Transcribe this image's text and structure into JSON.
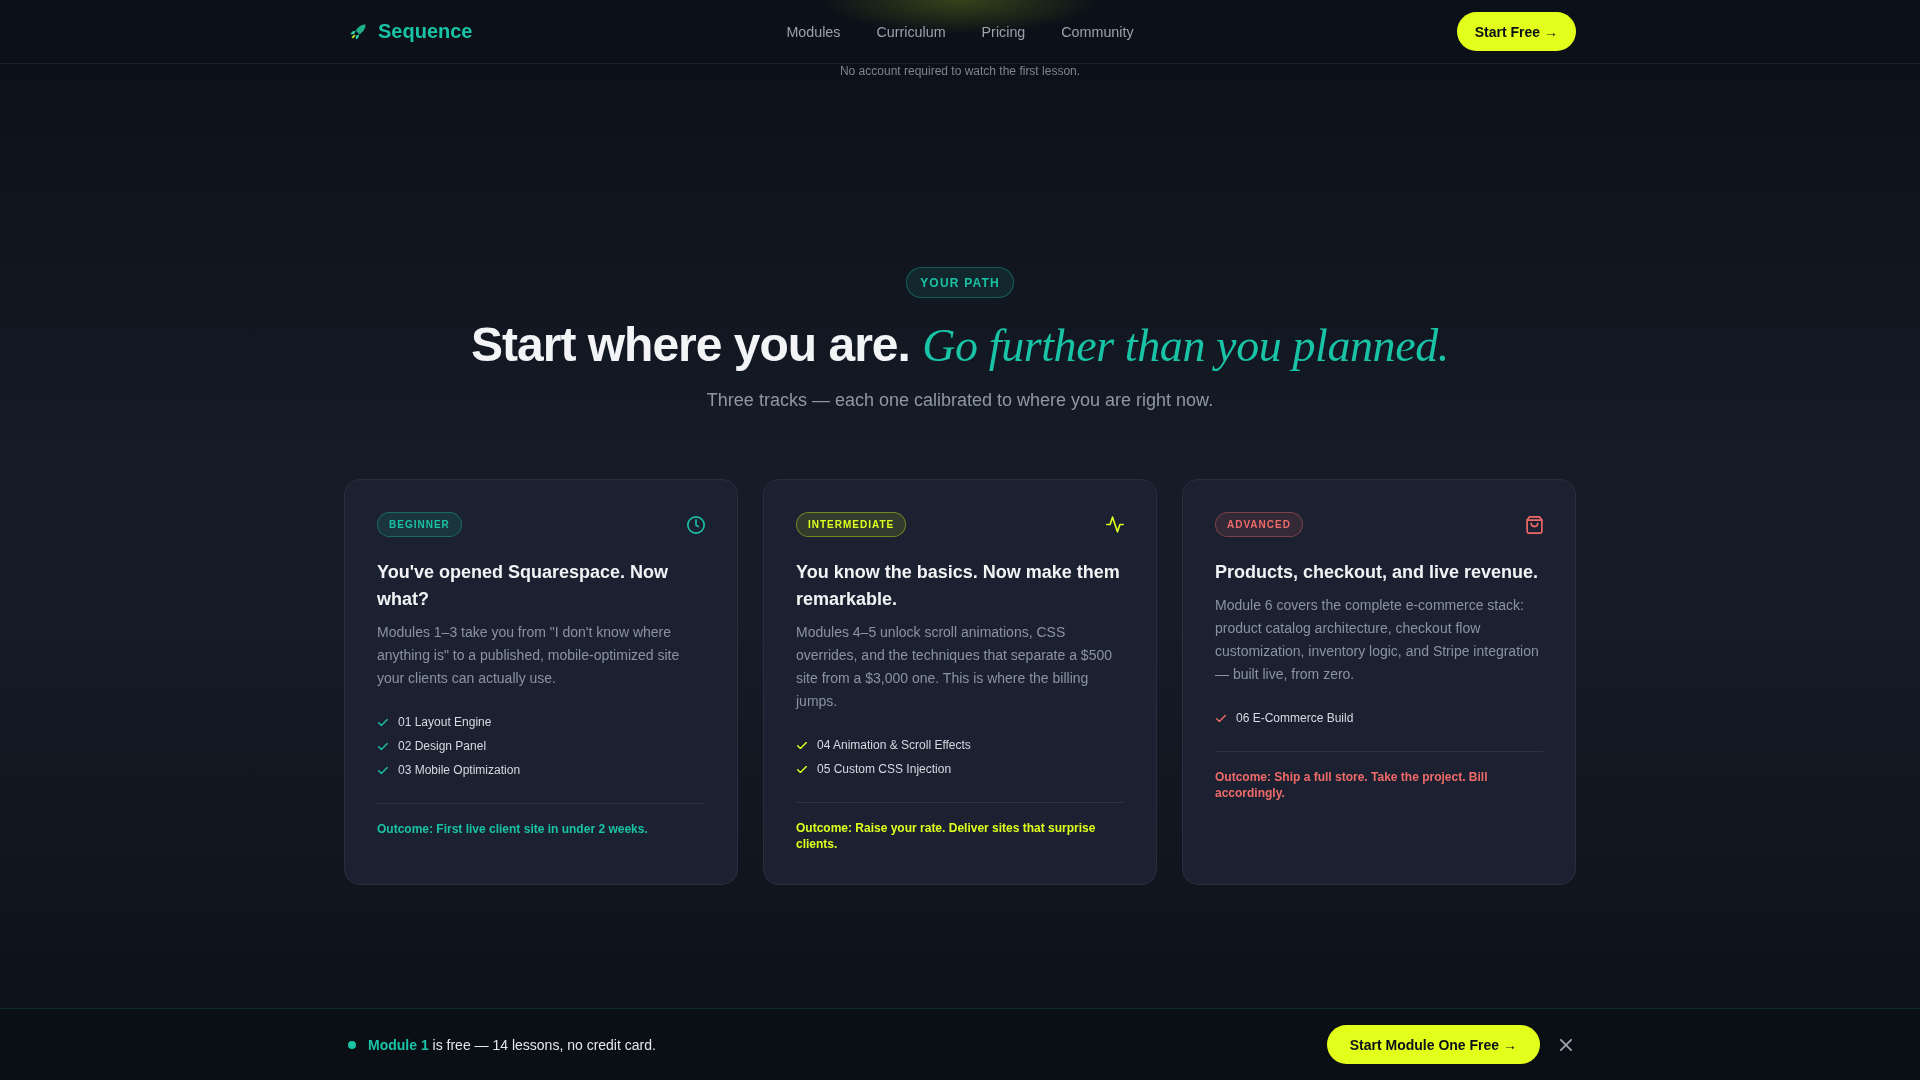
{
  "nav": {
    "brand": "Sequence",
    "links": [
      "Modules",
      "Curriculum",
      "Pricing",
      "Community"
    ],
    "cta": "Start Free →"
  },
  "hero_note": "No account required to watch the first lesson.",
  "path_section": {
    "eyebrow": "YOUR PATH",
    "title": "Start where you are.",
    "title_accent": "Go further than you planned.",
    "subtitle": "Three tracks — each one calibrated to where you are right now."
  },
  "tracks": [
    {
      "kind": "beginner",
      "tier": "BEGINNER",
      "color": "#19c3a6",
      "title": "You've opened Squarespace. Now what?",
      "description": "Modules 1–3 take you from \"I don't know where anything is\" to a published, mobile-optimized site your clients can actually use.",
      "modules": [
        "01 Layout Engine",
        "02 Design Panel",
        "03 Mobile Optimization"
      ],
      "outcome": "Outcome: First live client site in under 2 weeks."
    },
    {
      "kind": "intermediate",
      "tier": "INTERMEDIATE",
      "color": "#dfff1c",
      "title": "You know the basics. Now make them remarkable.",
      "description": "Modules 4–5 unlock scroll animations, CSS overrides, and the techniques that separate a $500 site from a $3,000 one. This is where the billing jumps.",
      "modules": [
        "04 Animation & Scroll Effects",
        "05 Custom CSS Injection"
      ],
      "outcome": "Outcome: Raise your rate. Deliver sites that surprise clients."
    },
    {
      "kind": "advanced",
      "tier": "ADVANCED",
      "color": "#f06a6a",
      "title": "Products, checkout, and live revenue.",
      "description": "Module 6 covers the complete e-commerce stack: product catalog architecture, checkout flow customization, inventory logic, and Stripe integration — built live, from zero.",
      "modules": [
        "06 E-Commerce Build"
      ],
      "outcome": "Outcome: Ship a full store. Take the project. Bill accordingly."
    }
  ],
  "promo_bar": {
    "message": "**Module 1** is free — 14 lessons, no credit card.",
    "button": "Start Module One Free →"
  }
}
